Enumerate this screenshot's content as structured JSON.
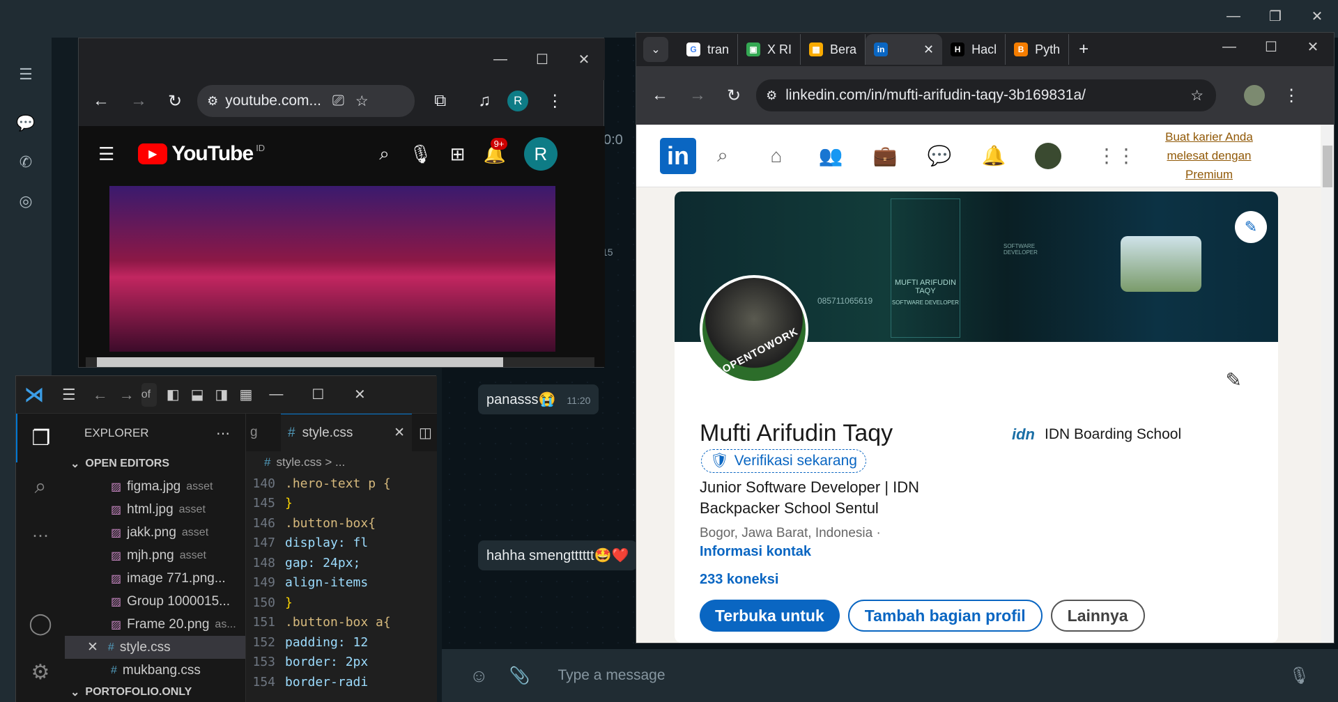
{
  "whatsapp": {
    "messages": [
      {
        "text": "panasss😭",
        "time": "11:20"
      },
      {
        "text": "hahha smengtttttt🤩❤️"
      }
    ],
    "compose_placeholder": "Type a message",
    "partial_time": "0:0",
    "partial_num": "15"
  },
  "youtube": {
    "url": "youtube.com...",
    "logo": "YouTube",
    "region": "ID",
    "notif_count": "9+",
    "avatar_letter": "R",
    "profile_letter": "R"
  },
  "linkedin_window": {
    "tabs": [
      {
        "label": "tran",
        "icon": "google-icon",
        "color": "#4285f4",
        "glyph": "G"
      },
      {
        "label": "X RI",
        "icon": "chat-icon",
        "color": "#34a853",
        "glyph": "▣"
      },
      {
        "label": "Bera",
        "icon": "classroom-icon",
        "color": "#f9ab00",
        "glyph": "▦"
      },
      {
        "label": "",
        "icon": "linkedin-icon",
        "color": "#0a66c2",
        "glyph": "in"
      },
      {
        "label": "Hacl",
        "icon": "hackerrank-icon",
        "color": "#000000",
        "glyph": "H"
      },
      {
        "label": "Pyth",
        "icon": "blogger-icon",
        "color": "#f57d00",
        "glyph": "B"
      }
    ],
    "url": "linkedin.com/in/mufti-arifudin-taqy-3b169831a/"
  },
  "linkedin": {
    "premium": "Buat karier Anda melesat dengan Premium",
    "name": "Mufti Arifudin Taqy",
    "verify": "Verifikasi sekarang",
    "headline": "Junior Software Developer | IDN Backpacker School Sentul",
    "location": "Bogor, Jawa Barat, Indonesia ·",
    "contact": "Informasi kontak",
    "connections": "233 koneksi",
    "org": "IDN Boarding School",
    "org_logo": "idn",
    "btn_open": "Terbuka untuk",
    "btn_add": "Tambah bagian profil",
    "btn_more": "Lainnya",
    "opentowork": "#OPENTOWORK",
    "banner_name": "MUFTI ARIFUDIN TAQY",
    "banner_role": "SOFTWARE DEVELOPER",
    "banner_side": "SOFTWARE DEVELOPER",
    "banner_phone": "085711065619",
    "colors": {
      "brand": "#0a66c2"
    }
  },
  "vscode": {
    "explorer": "EXPLORER",
    "open_editors": "OPEN EDITORS",
    "files": [
      {
        "name": "figma.jpg",
        "dir": "asset"
      },
      {
        "name": "html.jpg",
        "dir": "asset"
      },
      {
        "name": "jakk.png",
        "dir": "asset"
      },
      {
        "name": "mjh.png",
        "dir": "asset"
      },
      {
        "name": "image 771.png...",
        "dir": ""
      },
      {
        "name": "Group 1000015...",
        "dir": ""
      },
      {
        "name": "Frame 20.png",
        "dir": "as..."
      },
      {
        "name": "style.css",
        "dir": ""
      },
      {
        "name": "mukbang.css",
        "dir": ""
      }
    ],
    "folder": "PORTOFOLIO.ONLY",
    "tab_prev": "g",
    "tab_active": "style.css",
    "breadcrumb": "style.css > ...",
    "search_hint": "of",
    "code": [
      {
        "n": "140",
        "t": ".hero-text p {"
      },
      {
        "n": "145",
        "t": "}"
      },
      {
        "n": "146",
        "t": ".button-box{"
      },
      {
        "n": "147",
        "t": "    display: fl"
      },
      {
        "n": "148",
        "t": "    gap: 24px;"
      },
      {
        "n": "149",
        "t": "    align-items"
      },
      {
        "n": "150",
        "t": "}"
      },
      {
        "n": "151",
        "t": ".button-box a{"
      },
      {
        "n": "152",
        "t": "    padding: 12"
      },
      {
        "n": "153",
        "t": "    border: 2px"
      },
      {
        "n": "154",
        "t": "    border-radi"
      }
    ]
  }
}
